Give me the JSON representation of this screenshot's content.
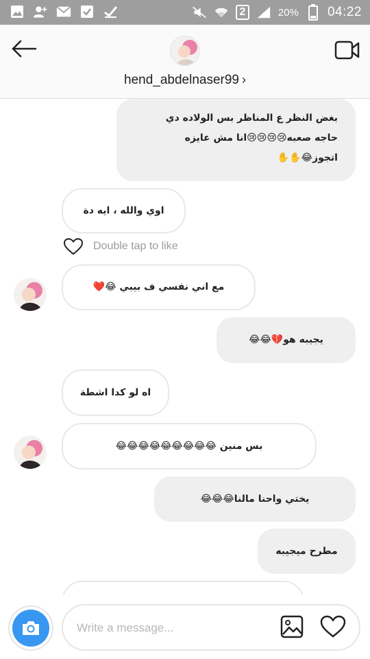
{
  "status_bar": {
    "battery": "20%",
    "time": "04:22",
    "sim_slot": "2"
  },
  "header": {
    "username": "hend_abdelnaser99",
    "chevron": "›"
  },
  "messages": [
    {
      "side": "sent",
      "text_lines": [
        "بغض النظر ع المناظر بس الولاده دي",
        "حاجه صعبه😢😢😢😢انا مش عايزه",
        "اتجوز😂✋✋"
      ]
    },
    {
      "side": "received",
      "text": "اوي والله ، ايه دة"
    },
    {
      "side": "received",
      "text": "مع اني نفسي ف بيبي 😂❤️"
    },
    {
      "side": "sent",
      "text": "يجيبه هو💔😂😂"
    },
    {
      "side": "received",
      "text": "اه لو كدا اشطة"
    },
    {
      "side": "received",
      "text": "بس منين 😂😂😂😂😂😂😂😂😂"
    },
    {
      "side": "sent",
      "text": "يختي واحنا مالنا😂😂😂"
    },
    {
      "side": "sent",
      "text": "مطرح ميجيبه"
    }
  ],
  "like_prompt": "Double tap to like",
  "composer": {
    "placeholder": "Write a message..."
  },
  "icons": [
    "image-icon",
    "person-add-icon",
    "mail-icon",
    "checkbox-icon",
    "check-icon",
    "mute-icon",
    "wifi-icon",
    "signal-icon",
    "battery-icon",
    "back-arrow-icon",
    "video-camera-icon",
    "heart-outline-icon",
    "camera-icon",
    "gallery-icon"
  ],
  "colors": {
    "status_bar": "#9e9e9e",
    "sent_bubble": "#efefef",
    "camera_button": "#3897f0",
    "like_text": "#9b9b9b"
  }
}
